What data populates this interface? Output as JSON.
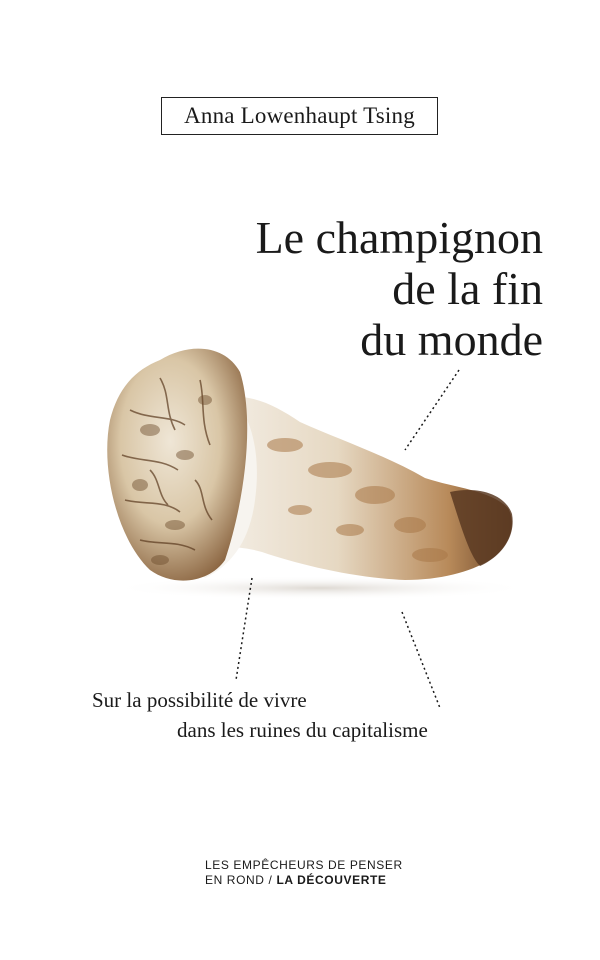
{
  "cover": {
    "author": "Anna Lowenhaupt Tsing",
    "title_lines": [
      "Le champignon",
      "de la fin",
      "du monde"
    ],
    "subtitle_lines": [
      "Sur la possibilité de vivre",
      "dans les ruines du capitalisme"
    ],
    "publisher": {
      "line1": "LES EMPÊCHEURS DE PENSER",
      "line2_left": "EN ROND",
      "separator": "/",
      "line2_right": "LA DÉCOUVERTE"
    },
    "colors": {
      "background": "#ffffff",
      "text": "#1a1a1a",
      "cap_light": "#e8dcc8",
      "cap_dark": "#6b4a2a",
      "stem_light": "#f2ede6",
      "stem_dark": "#9a6a3a"
    }
  }
}
